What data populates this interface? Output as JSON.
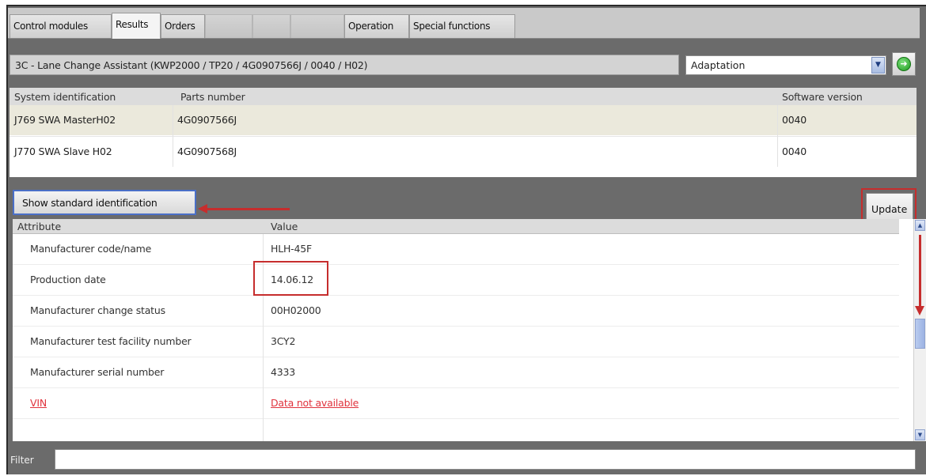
{
  "tabs": [
    {
      "label": "Control modules"
    },
    {
      "label": "Results"
    },
    {
      "label": "Orders"
    },
    {
      "label": "Operation"
    },
    {
      "label": "Special functions"
    }
  ],
  "module_bar": {
    "text": "3C - Lane Change Assistant  (KWP2000 / TP20 / 4G0907566J   / 0040 / H02)"
  },
  "function_select": {
    "value": "Adaptation"
  },
  "identification": {
    "headers": [
      "System identification",
      "Parts number",
      "Software version"
    ],
    "rows": [
      [
        "J769  SWA MasterH02",
        "4G0907566J",
        "0040"
      ],
      [
        "J770  SWA Slave H02",
        "4G0907568J",
        "0040"
      ]
    ]
  },
  "buttons": {
    "show_standard": "Show standard identification",
    "update": "Update"
  },
  "attributes": {
    "headers": [
      "Attribute",
      "Value"
    ],
    "rows": [
      [
        "Manufacturer code/name",
        "HLH-45F"
      ],
      [
        "Production date",
        "14.06.12"
      ],
      [
        "Manufacturer change status",
        "00H02000"
      ],
      [
        "Manufacturer test facility number",
        "3CY2"
      ],
      [
        "Manufacturer serial number",
        "4333"
      ],
      [
        "VIN",
        "Data not available"
      ]
    ]
  },
  "filter": {
    "label": "Filter",
    "value": ""
  },
  "colors": {
    "annotation": "#c62d2d",
    "focus": "#4a6fc7",
    "missing_data": "#e0333d"
  },
  "icons": {
    "go": "green-arrow-right-icon",
    "dropdown": "chevron-down-icon"
  }
}
